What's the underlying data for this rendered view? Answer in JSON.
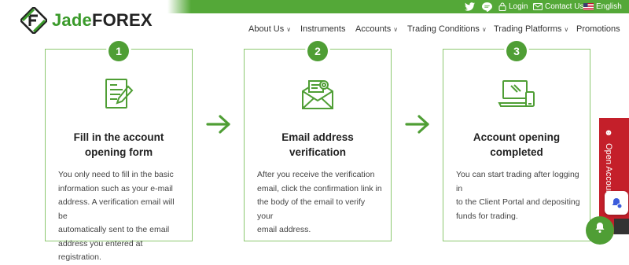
{
  "brand": {
    "name_part1": "Jade",
    "name_part2": "FOREX",
    "logo_icon": "jadeforex-logo-icon"
  },
  "utility_bar": {
    "icons": [
      "twitter-icon",
      "line-chat-icon"
    ],
    "login_label": "Login",
    "contact_label": "Contact Us",
    "language_label": "English",
    "accent_color": "#54a838"
  },
  "nav": {
    "items": [
      {
        "label": "About Us",
        "has_dropdown": true
      },
      {
        "label": "Instruments",
        "has_dropdown": false
      },
      {
        "label": "Accounts",
        "has_dropdown": true
      },
      {
        "label": "Trading Conditions",
        "has_dropdown": true
      },
      {
        "label": "Trading Platforms",
        "has_dropdown": true
      },
      {
        "label": "Promotions",
        "has_dropdown": false
      }
    ]
  },
  "steps": [
    {
      "number": "1",
      "icon": "form-document-pen-icon",
      "title_line1": "Fill in the account",
      "title_line2": "opening form",
      "desc": [
        "You only need to fill in the basic",
        "information such as your e-mail",
        "address. A verification email will be",
        "automatically sent to the email",
        "address you entered at registration."
      ]
    },
    {
      "number": "2",
      "icon": "email-envelope-icon",
      "title_line1": "Email address",
      "title_line2": "verification",
      "desc": [
        "After you receive the verification",
        "email, click the confirmation link in",
        "the body of the email to verify your",
        "email address."
      ]
    },
    {
      "number": "3",
      "icon": "laptop-phone-icon",
      "title_line1": "Account opening",
      "title_line2": "completed",
      "desc": [
        "You can start trading after logging in",
        "to the Client Portal and depositing",
        "funds for trading."
      ]
    }
  ],
  "side_tab": {
    "label": "Open Account",
    "color": "#c41f2a"
  },
  "colors": {
    "green": "#4f9e35",
    "card_border": "#8cc870"
  }
}
